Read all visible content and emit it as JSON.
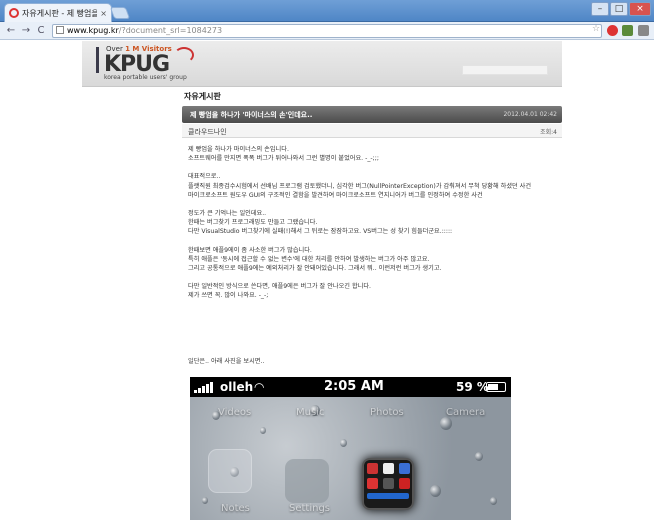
{
  "browser": {
    "tab_title": "자유게시판 - 제 빵엄을 하나",
    "tab_close": "×",
    "url_domain": "www.kpug.kr",
    "url_path": "/?document_srl=1084273",
    "window_buttons": [
      "–",
      "□",
      "×"
    ],
    "nav": {
      "back": "←",
      "forward": "→",
      "reload": "C"
    },
    "star": "☆"
  },
  "header": {
    "logo_over_prefix": "Over",
    "logo_over_highlight": "1 M Visitors",
    "logo_main": "KPUG",
    "logo_sub": "korea portable users' group"
  },
  "board": {
    "title": "자유게시판"
  },
  "post": {
    "title": "제 빵엄을 하나가 '마이너스의 손'인데요..",
    "date": "2012.04.01 02:42",
    "author": "클라우드나인",
    "views": "조회:4",
    "lines": [
      "제 빵엄을 하나가 마이너스의 손입니다.",
      "소프트웨어를 만지면 폭폭 버그가 튀어나와서 그런 별명이 붙었어요. -_-;;;",
      "",
      "대표적으로..",
      "플랫직원 최종검수시험에서 선배님 프로그램 검토했더니, 심각한 버그(NullPointerException)가 감춰져서 무척 당황해 하셨던 사건",
      "마이크로소프트 원도우 GUI의 구조적인 결함을 발견하여 마이크로소프트 연지니어가 버그를 인정하여 수정한 사건",
      "",
      "정도가 큰 기억나는 일인데요..",
      "한때는 버그찾기 프로그래밍도 만들고 그랬습니다.",
      "다만 VisualStudio 버그찾기에 실패(!)해서 그 뒤로는 잠잠하고요. VS버그는 성 찾기 힘들더군요.:::::",
      "",
      "한때보면 애플9에이 좀 사소한 버그가 많습니다.",
      "특히 애플은 '동시에 접근할 수 없는 변수'에 대한 처리를 안하여 발생하는 버그가 아주 많고요.",
      "그리고 공통적으로 애플9에는 예외처리가 잘 안돼어있습니다. 그래서 뭐.. 이런저런 버그가 생기고.",
      "",
      "다만 일반적인 방식으로 쓴다면, 애플9에은 버그가 잘 안나오긴 합니다.",
      "제가 쓰면 꼭. 많이 나와요. -_-;"
    ],
    "tail": "일단은.. 아래 사진을 보시면.."
  },
  "phone": {
    "carrier": "olleh",
    "time": "2:05 AM",
    "battery": "59 %",
    "battery_level": 0.59,
    "labels": [
      "Videos",
      "Music",
      "Photos",
      "Camera",
      "Notes",
      "Settings"
    ]
  },
  "colors": {
    "titlebar": "#4f86c6",
    "post_bar": "#4b4b4b",
    "logo_red": "#c33"
  }
}
